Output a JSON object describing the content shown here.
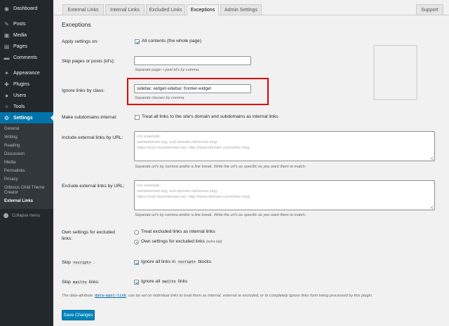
{
  "sidebar": {
    "menu": [
      {
        "label": "Dashboard",
        "icon": "dashboard-icon",
        "glyph": "◉"
      },
      {
        "label": "Posts",
        "icon": "pin-icon",
        "glyph": "✎"
      },
      {
        "label": "Media",
        "icon": "media-icon",
        "glyph": "▣"
      },
      {
        "label": "Pages",
        "icon": "pages-icon",
        "glyph": "▤"
      },
      {
        "label": "Comments",
        "icon": "comments-icon",
        "glyph": "▬"
      },
      {
        "label": "Appearance",
        "icon": "appearance-icon",
        "glyph": "✦"
      },
      {
        "label": "Plugins",
        "icon": "plugins-icon",
        "glyph": "✚"
      },
      {
        "label": "Users",
        "icon": "users-icon",
        "glyph": "●"
      },
      {
        "label": "Tools",
        "icon": "tools-icon",
        "glyph": "✧"
      },
      {
        "label": "Settings",
        "icon": "settings-icon",
        "glyph": "⚙"
      }
    ],
    "submenu": [
      "General",
      "Writing",
      "Reading",
      "Discussion",
      "Media",
      "Permalinks",
      "Privacy",
      "Orbisius Child Theme Creator",
      "External Links"
    ],
    "collapse_label": "Collapse menu"
  },
  "tabs": [
    "External Links",
    "Internal Links",
    "Excluded Links",
    "Exceptions",
    "Admin Settings"
  ],
  "support_tab": "Support",
  "section_title": "Exceptions",
  "apply": {
    "label": "Apply settings on:",
    "option": "All contents (the whole page)"
  },
  "skip_pages": {
    "label": "Skip pages or posts (id's):",
    "value": "",
    "desc": "Separate page- / post-id's by comma."
  },
  "ignore_class": {
    "label": "Ignore links by class:",
    "value": "sidebar, widget-sidebar, frontier-widget",
    "desc": "Separate classes by comma."
  },
  "subdomains": {
    "label": "Make subdomains internal:",
    "option": "Treat all links to the site's domain and subdomains as internal links"
  },
  "include_urls": {
    "label": "Include external links by URL:",
    "placeholder": "For example:\nsomedomain.org, sub.domain.net/some-slug\nhttps://sub.moredomain.net, http://www.domain.com/other-slug",
    "desc": "Separate url's by comma and/or a line break. Write the url's as specific as you want them to match."
  },
  "exclude_urls": {
    "label": "Exclude external links by URL:",
    "placeholder": "For example:\nsomedomain.org, sub.domain.net/some-slug\nhttps://sub.moredomain.net, http://www.domain.com/other-slug",
    "desc": "Separate url's by comma and/or a line break. Write the url's as specific as you want them to match."
  },
  "own_settings": {
    "label_line1": "Own settings for excluded",
    "label_line2": "links:",
    "option1": "Treat excluded links as internal links",
    "option2": "Own settings for excluded links",
    "option2_note": "(extra tab)"
  },
  "skip_script": {
    "label_pre": "Skip",
    "label_code": "<script>",
    "label_post": ":",
    "opt_pre": "Ignore all links in",
    "opt_code": "<script>",
    "opt_post": "blocks"
  },
  "skip_mailto": {
    "label_pre": "Skip",
    "label_code": "mailto",
    "label_post": "links:",
    "opt_pre": "Ignore all",
    "opt_code": "mailto",
    "opt_post": "links"
  },
  "footnote": {
    "pre": "The data-attribute",
    "code": "data-wpel-link",
    "post": "can be set on individual links to treat them as internal, external or excluded, or to completely ignore links form being processed by this plugin."
  },
  "save_button": "Save Changes",
  "colors": {
    "accent": "#0073aa",
    "highlight": "#e00000",
    "sidebar": "#23282d"
  }
}
